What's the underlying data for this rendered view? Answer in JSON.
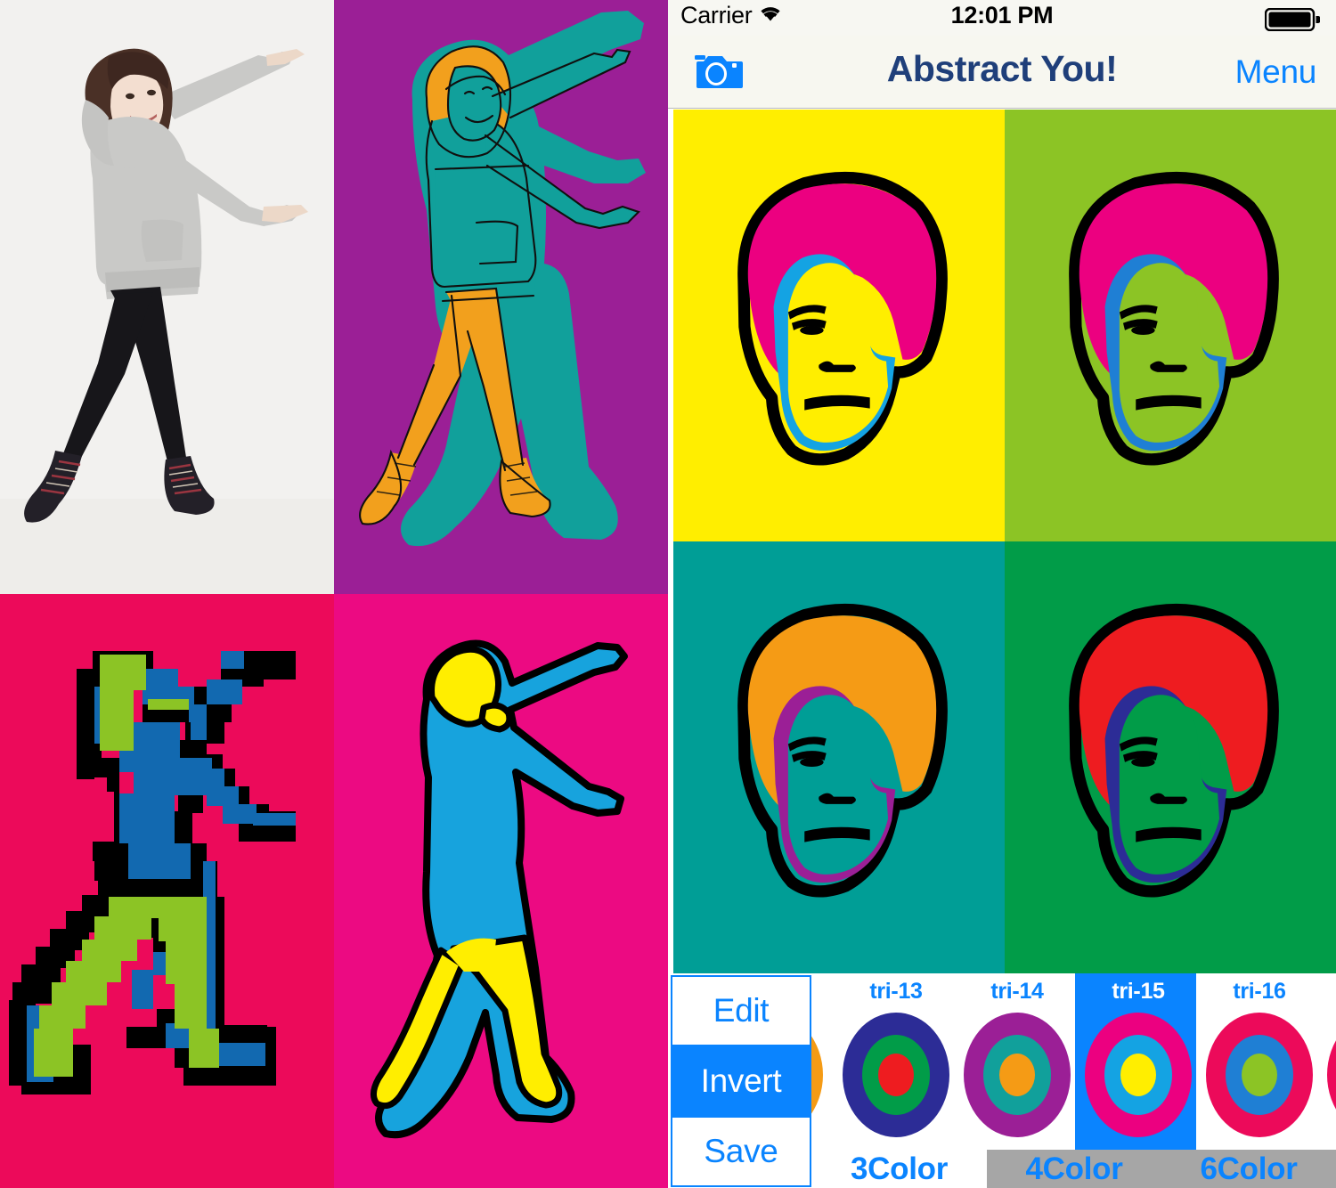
{
  "app": {
    "title": "Abstract You!"
  },
  "status_bar": {
    "carrier": "Carrier",
    "wifi_icon": "wifi-icon",
    "time": "12:01 PM",
    "battery_icon": "battery-full-icon"
  },
  "nav_bar": {
    "camera_icon": "camera-icon",
    "title": "Abstract You!",
    "menu_label": "Menu",
    "title_color": "#1f3f7a",
    "tint_color": "#0a84ff"
  },
  "preview_grid": {
    "name": "pop-art-quad-preview",
    "panels": [
      {
        "position": "top-left",
        "background": "#ffee00",
        "hair": "#ec0080",
        "shadow": "#14a3e3",
        "skin": "#ffee00",
        "outline": "#000000"
      },
      {
        "position": "top-right",
        "background": "#8cc425",
        "hair": "#ec0080",
        "shadow": "#1f7fd4",
        "skin": "#8cc425",
        "outline": "#000000"
      },
      {
        "position": "bottom-left",
        "background": "#009e96",
        "hair": "#f59b15",
        "shadow": "#9b1f96",
        "skin": "#009e96",
        "outline": "#000000"
      },
      {
        "position": "bottom-right",
        "background": "#019c48",
        "hair": "#ee1c20",
        "shadow": "#2c2c96",
        "skin": "#019c48",
        "outline": "#000000"
      }
    ]
  },
  "montage": {
    "name": "source-and-variations",
    "panels": [
      {
        "position": "top-left",
        "label": "original-photo",
        "background": "#f2f1ef"
      },
      {
        "position": "top-right",
        "label": "teal-orange-sketch",
        "background": "#9b1f96",
        "body": "#11a09b",
        "accent": "#f2a01d"
      },
      {
        "position": "bottom-left",
        "label": "pixelated-blocks",
        "background": "#ec0a5a",
        "body": "#1269b0",
        "accent": "#8cc425"
      },
      {
        "position": "bottom-right",
        "label": "flat-silhouette",
        "background": "#ec0a82",
        "body": "#17a3dd",
        "accent": "#ffee00"
      }
    ]
  },
  "toolbar": {
    "side_buttons": [
      {
        "label": "Edit",
        "name": "edit-button",
        "selected": false
      },
      {
        "label": "Invert",
        "name": "invert-button",
        "selected": true
      },
      {
        "label": "Save",
        "name": "save-button",
        "selected": false
      }
    ],
    "swatches": [
      {
        "label": "",
        "selected": false,
        "outer": "#f59b15",
        "mid": "#0a84ff",
        "inner": "#ffffff",
        "partial": "left"
      },
      {
        "label": "tri-13",
        "selected": false,
        "outer": "#2c2c96",
        "mid": "#019c48",
        "inner": "#ee1c20"
      },
      {
        "label": "tri-14",
        "selected": false,
        "outer": "#9b1f96",
        "mid": "#11a09b",
        "inner": "#f59b15"
      },
      {
        "label": "tri-15",
        "selected": true,
        "outer": "#ec0080",
        "mid": "#14a3e3",
        "inner": "#ffee00"
      },
      {
        "label": "tri-16",
        "selected": false,
        "outer": "#ec0a5a",
        "mid": "#1f7fd4",
        "inner": "#8cc425"
      },
      {
        "label": "",
        "selected": false,
        "outer": "#ec0a5a",
        "mid": "#ffffff",
        "inner": "#ffffff",
        "partial": "right"
      }
    ],
    "tabs": [
      {
        "label": "3Color",
        "name": "tab-3color",
        "active": true
      },
      {
        "label": "4Color",
        "name": "tab-4color",
        "active": false
      },
      {
        "label": "6Color",
        "name": "tab-6color",
        "active": false
      }
    ]
  }
}
